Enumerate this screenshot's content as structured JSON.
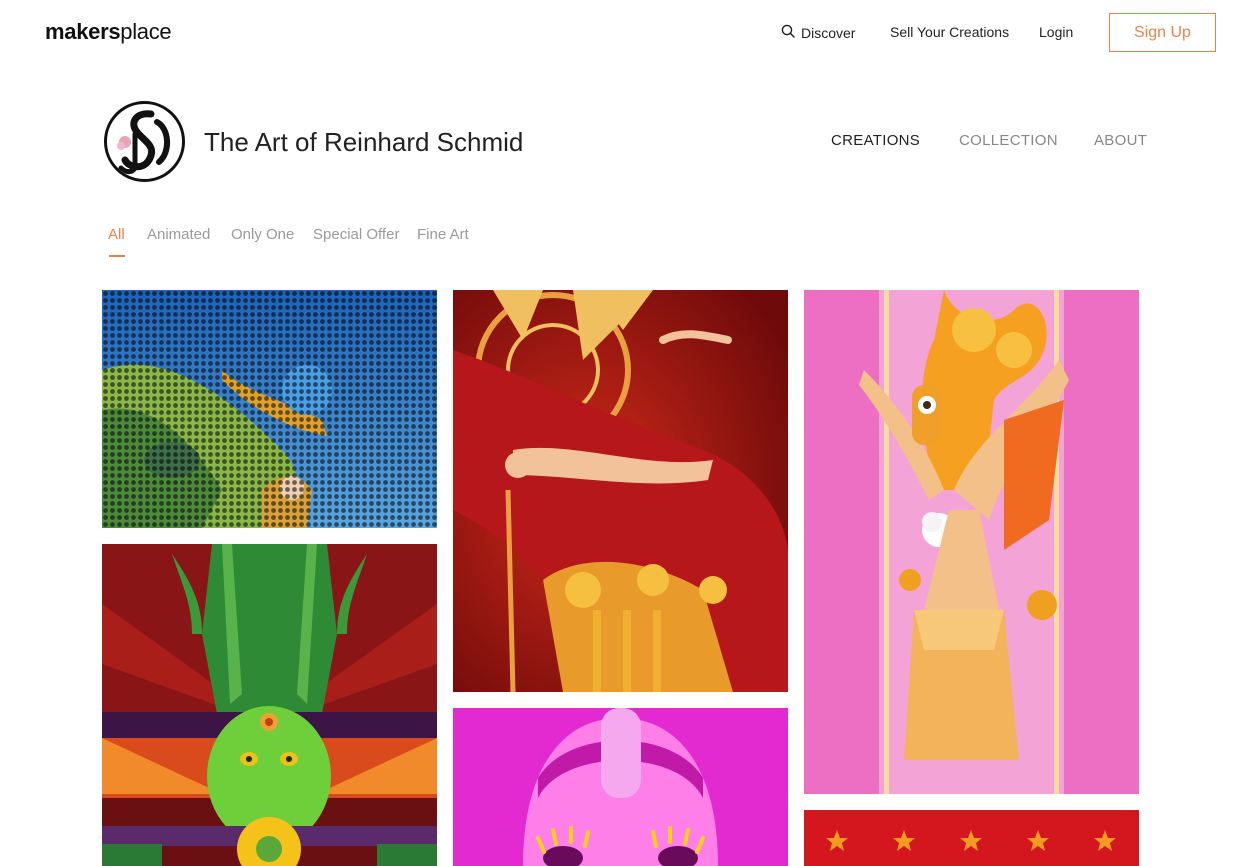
{
  "brand": {
    "bold": "makers",
    "light": "place"
  },
  "topnav": {
    "discover": "Discover",
    "sell": "Sell Your Creations",
    "login": "Login",
    "signup": "Sign Up"
  },
  "profile": {
    "name": "The Art of Reinhard Schmid",
    "tabs": [
      "CREATIONS",
      "COLLECTION",
      "ABOUT"
    ],
    "active_tab": "CREATIONS"
  },
  "filters": {
    "items": [
      "All",
      "Animated",
      "Only One",
      "Special Offer",
      "Fine Art"
    ],
    "active": "All"
  },
  "colors": {
    "accent": "#e8844a",
    "text": "#222222",
    "muted": "#9a9a9a"
  },
  "icons": {
    "discover": "search-icon",
    "avatar": "rs-monogram-logo"
  }
}
